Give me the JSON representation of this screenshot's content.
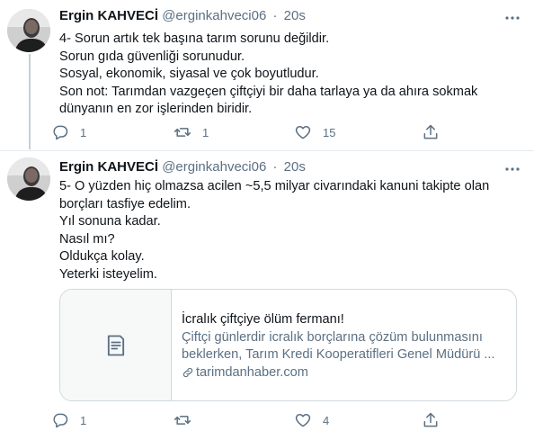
{
  "tweets": [
    {
      "author_name": "Ergin KAHVECİ",
      "handle": "@erginkahveci06",
      "separator": "·",
      "time": "20s",
      "lines": [
        "4- Sorun artık tek başına tarım sorunu değildir.",
        "Sorun gıda güvenliği sorunudur.",
        "Sosyal, ekonomik, siyasal ve çok boyutludur.",
        "Son not: Tarımdan vazgeçen çiftçiyi bir daha tarlaya ya da ahıra sokmak",
        "dünyanın en zor işlerinden biridir."
      ],
      "actions": {
        "reply_count": "1",
        "retweet_count": "1",
        "like_count": "15",
        "share_count": ""
      }
    },
    {
      "author_name": "Ergin KAHVECİ",
      "handle": "@erginkahveci06",
      "separator": "·",
      "time": "20s",
      "lines": [
        "5- O yüzden hiç olmazsa acilen ~5,5 milyar civarındaki kanuni  takipte olan",
        "borçları tasfiye edelim.",
        "Yıl sonuna kadar.",
        "Nasıl mı?",
        "Oldukça kolay.",
        "Yeterki isteyelim."
      ],
      "card": {
        "title": "İcralık çiftçiye ölüm fermanı!",
        "description_line1": "Çiftçi günlerdir icralık borçlarına çözüm bulunmasını",
        "description_line2": "beklerken, Tarım Kredi Kooperatifleri Genel Müdürü ...",
        "domain": "tarimdanhaber.com"
      },
      "actions": {
        "reply_count": "1",
        "retweet_count": "",
        "like_count": "4",
        "share_count": ""
      }
    }
  ],
  "icons": {
    "reply": "reply-icon",
    "retweet": "retweet-icon",
    "like": "heart-icon",
    "share": "share-icon",
    "more": "more-options-icon",
    "link": "link-icon",
    "card_placeholder": "document-icon"
  },
  "colors": {
    "text_primary": "#0f1419",
    "text_secondary": "#5b7083",
    "border": "#e6ecf0",
    "thread_line": "#c4cfd6"
  }
}
